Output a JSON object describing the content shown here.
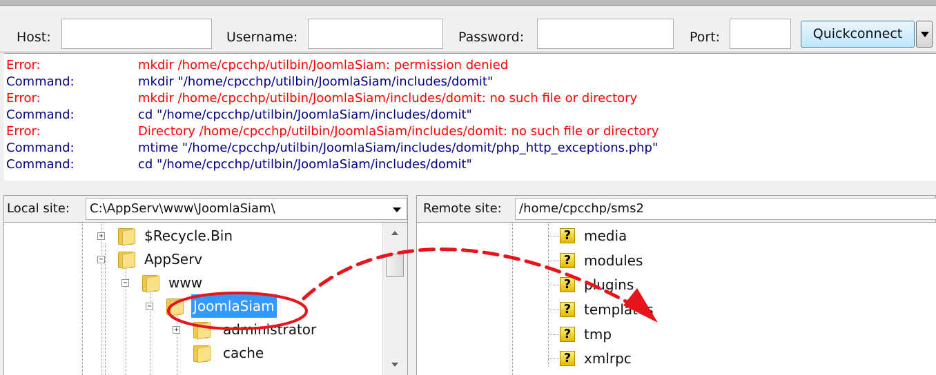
{
  "toolbar": {
    "host_label": "Host:",
    "host_value": "",
    "username_label": "Username:",
    "username_value": "",
    "password_label": "Password:",
    "password_value": "",
    "port_label": "Port:",
    "port_value": "",
    "quickconnect_label": "Quickconnect"
  },
  "log": [
    {
      "type": "Error:",
      "message": "mkdir /home/cpcchp/utilbin/JoomlaSiam: permission denied",
      "kind": "error"
    },
    {
      "type": "Command:",
      "message": "mkdir \"/home/cpcchp/utilbin/JoomlaSiam/includes/domit\"",
      "kind": "command"
    },
    {
      "type": "Error:",
      "message": "mkdir /home/cpcchp/utilbin/JoomlaSiam/includes/domit: no such file or directory",
      "kind": "error"
    },
    {
      "type": "Command:",
      "message": "cd \"/home/cpcchp/utilbin/JoomlaSiam/includes/domit\"",
      "kind": "command"
    },
    {
      "type": "Error:",
      "message": "Directory /home/cpcchp/utilbin/JoomlaSiam/includes/domit: no such file or directory",
      "kind": "error"
    },
    {
      "type": "Command:",
      "message": "mtime \"/home/cpcchp/utilbin/JoomlaSiam/includes/domit/php_http_exceptions.php\"",
      "kind": "command"
    },
    {
      "type": "Command:",
      "message": "cd \"/home/cpcchp/utilbin/JoomlaSiam/includes/domit\"",
      "kind": "command"
    }
  ],
  "local": {
    "label": "Local site:",
    "path": "C:\\AppServ\\www\\JoomlaSiam\\",
    "tree": [
      "$Recycle.Bin",
      "AppServ",
      "www",
      "JoomlaSiam",
      "administrator",
      "cache"
    ]
  },
  "remote": {
    "label": "Remote site:",
    "path": "/home/cpcchp/sms2",
    "tree": [
      "media",
      "modules",
      "plugins",
      "templates",
      "tmp",
      "xmlrpc"
    ]
  },
  "colors": {
    "error": "#ff0000",
    "command": "#000080",
    "annotation": "#e8141b",
    "selection": "#3399ff"
  }
}
